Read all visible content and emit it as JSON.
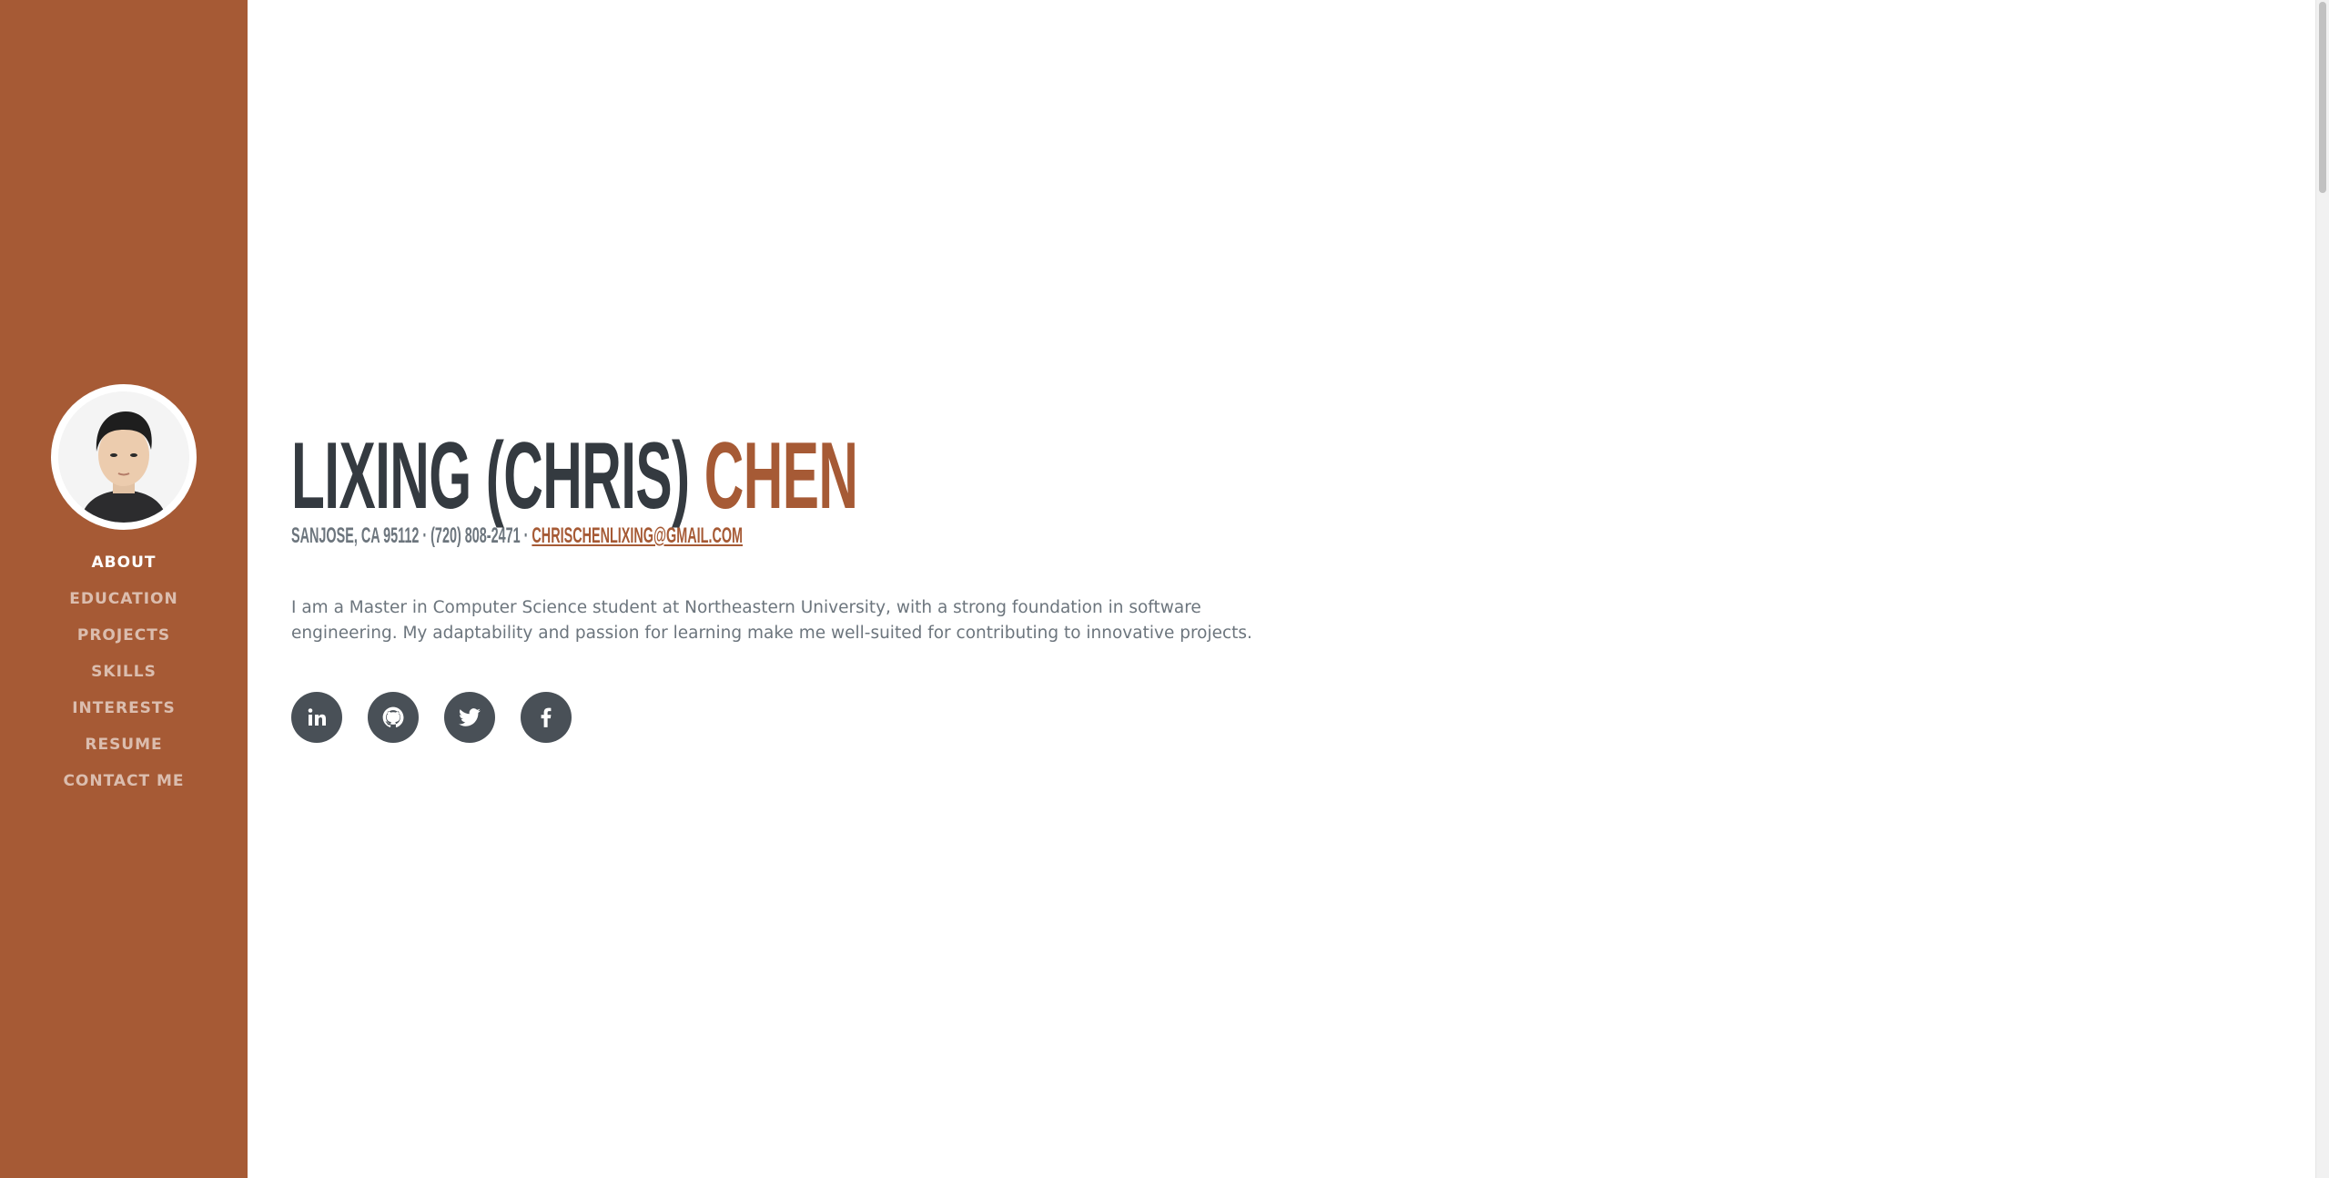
{
  "profile": {
    "first_name": "LIXING (CHRIS)",
    "last_name": "CHEN",
    "address_phone": "SANJOSE, CA 95112 · (720) 808-2471 · ",
    "email": "CHRISCHENLIXING@GMAIL.COM",
    "bio": "I am a Master in Computer Science student at Northeastern University, with a strong foundation in software engineering. My adaptability and passion for learning make me well-suited for contributing to innovative projects."
  },
  "nav": {
    "items": [
      {
        "label": "ABOUT",
        "active": true
      },
      {
        "label": "EDUCATION"
      },
      {
        "label": "PROJECTS"
      },
      {
        "label": "SKILLS"
      },
      {
        "label": "INTERESTS"
      },
      {
        "label": "RESUME"
      },
      {
        "label": "CONTACT ME"
      }
    ]
  },
  "social": [
    "linkedin-icon",
    "github-icon",
    "twitter-icon",
    "facebook-icon"
  ],
  "colors": {
    "primary": "#a65a35",
    "dark": "#343a40",
    "muted": "#6c757d",
    "icon_bg": "#495057"
  }
}
